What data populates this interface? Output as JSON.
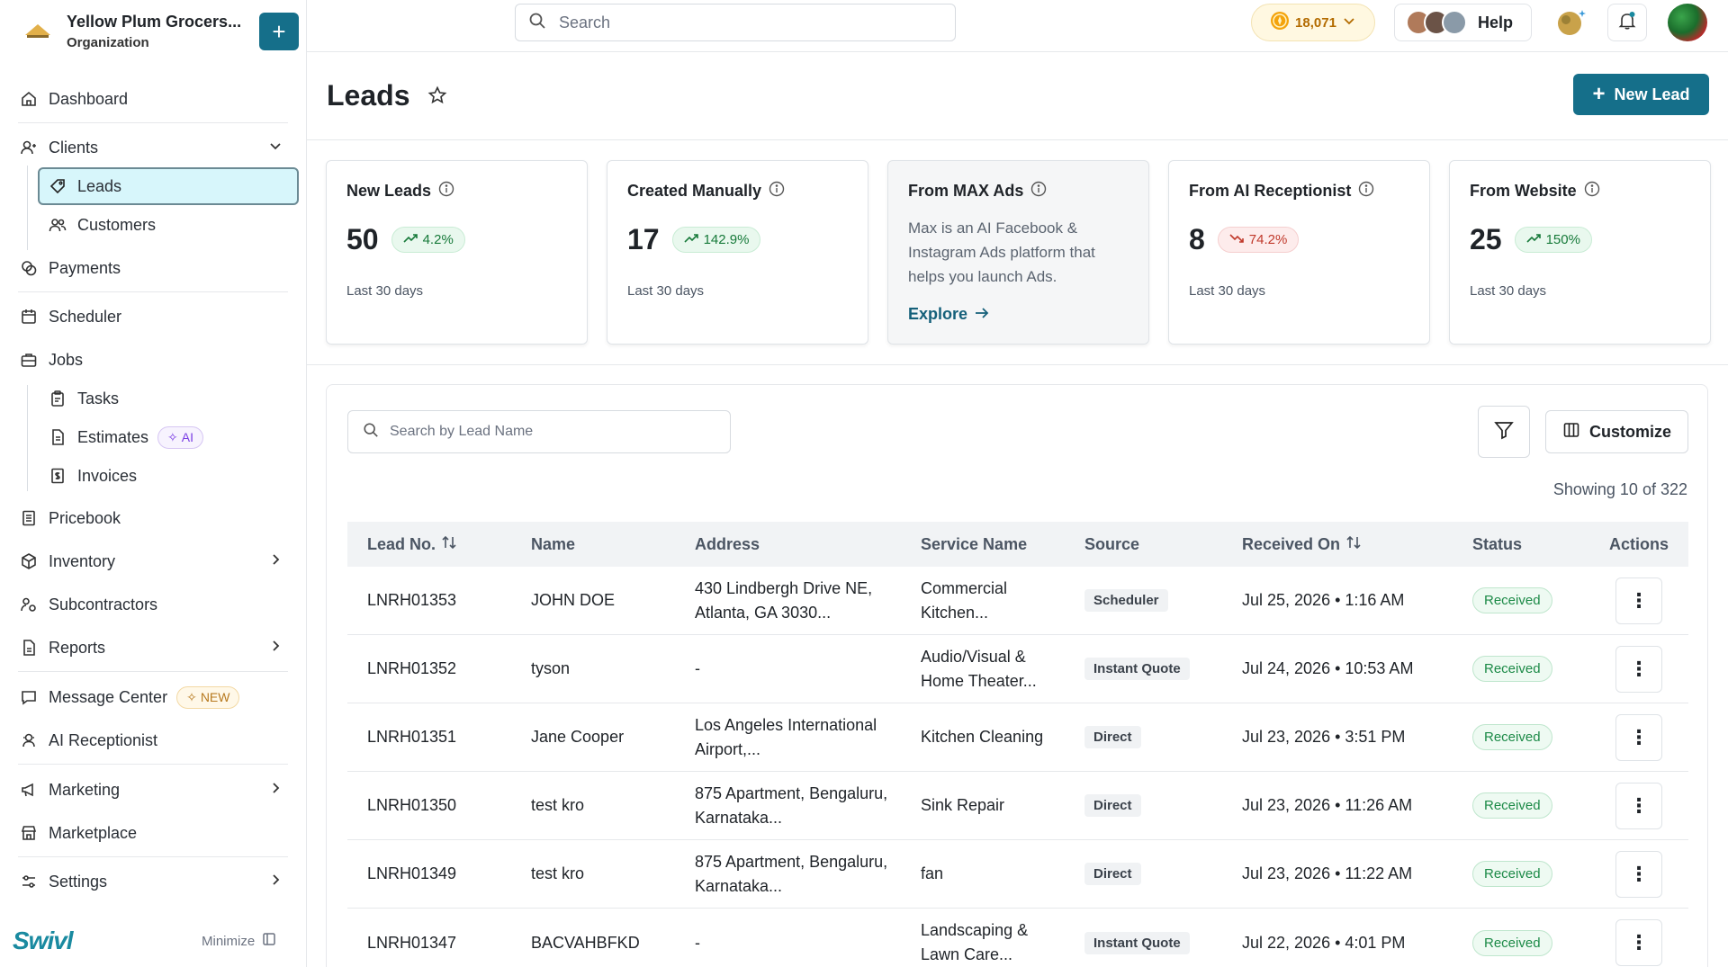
{
  "org": {
    "name": "Yellow Plum Grocers...",
    "subtitle": "Organization"
  },
  "sidebar": {
    "items": [
      {
        "label": "Dashboard"
      },
      {
        "label": "Clients"
      },
      {
        "label": "Leads"
      },
      {
        "label": "Customers"
      },
      {
        "label": "Payments"
      },
      {
        "label": "Scheduler"
      },
      {
        "label": "Jobs"
      },
      {
        "label": "Tasks"
      },
      {
        "label": "Estimates"
      },
      {
        "label": "Invoices"
      },
      {
        "label": "Pricebook"
      },
      {
        "label": "Inventory"
      },
      {
        "label": "Subcontractors"
      },
      {
        "label": "Reports"
      },
      {
        "label": "Message Center"
      },
      {
        "label": "AI Receptionist"
      },
      {
        "label": "Marketing"
      },
      {
        "label": "Marketplace"
      },
      {
        "label": "Settings"
      }
    ],
    "badges": {
      "ai": "AI",
      "new": "NEW"
    },
    "brand": "Swivl",
    "minimize": "Minimize"
  },
  "topbar": {
    "search_placeholder": "Search",
    "coins": "18,071",
    "help": "Help"
  },
  "page": {
    "title": "Leads",
    "new_button": "New Lead"
  },
  "cards": [
    {
      "title": "New Leads",
      "value": "50",
      "change": "4.2%",
      "trend": "up",
      "footer": "Last 30 days"
    },
    {
      "title": "Created Manually",
      "value": "17",
      "change": "142.9%",
      "trend": "up",
      "footer": "Last 30 days"
    },
    {
      "title": "From MAX Ads",
      "description": "Max is an AI Facebook & Instagram Ads platform that helps you launch Ads.",
      "link": "Explore"
    },
    {
      "title": "From AI Receptionist",
      "value": "8",
      "change": "74.2%",
      "trend": "down",
      "footer": "Last 30 days"
    },
    {
      "title": "From Website",
      "value": "25",
      "change": "150%",
      "trend": "up",
      "footer": "Last 30 days"
    }
  ],
  "table": {
    "search_placeholder": "Search by Lead Name",
    "customize": "Customize",
    "showing": "Showing 10 of 322",
    "columns": [
      "Lead No.",
      "Name",
      "Address",
      "Service Name",
      "Source",
      "Received On",
      "Status",
      "Actions"
    ],
    "rows": [
      {
        "lead_no": "LNRH01353",
        "name": "JOHN DOE",
        "address": "430 Lindbergh Drive NE, Atlanta, GA 3030...",
        "service": "Commercial Kitchen...",
        "source": "Scheduler",
        "received": "Jul 25, 2026 • 1:16 AM",
        "status": "Received"
      },
      {
        "lead_no": "LNRH01352",
        "name": "tyson",
        "address": "-",
        "service": "Audio/Visual & Home Theater...",
        "source": "Instant Quote",
        "received": "Jul 24, 2026 • 10:53 AM",
        "status": "Received"
      },
      {
        "lead_no": "LNRH01351",
        "name": "Jane Cooper",
        "address": "Los Angeles International Airport,...",
        "service": "Kitchen Cleaning",
        "source": "Direct",
        "received": "Jul 23, 2026 • 3:51 PM",
        "status": "Received"
      },
      {
        "lead_no": "LNRH01350",
        "name": "test kro",
        "address": "875 Apartment, Bengaluru, Karnataka...",
        "service": "Sink Repair",
        "source": "Direct",
        "received": "Jul 23, 2026 • 11:26 AM",
        "status": "Received"
      },
      {
        "lead_no": "LNRH01349",
        "name": "test kro",
        "address": "875 Apartment, Bengaluru, Karnataka...",
        "service": "fan",
        "source": "Direct",
        "received": "Jul 23, 2026 • 11:22 AM",
        "status": "Received"
      },
      {
        "lead_no": "LNRH01347",
        "name": "BACVAHBFKD",
        "address": "-",
        "service": "Landscaping & Lawn Care...",
        "source": "Instant Quote",
        "received": "Jul 22, 2026 • 4:01 PM",
        "status": "Received"
      }
    ]
  },
  "colors": {
    "accent": "#156f8a",
    "active_bg": "#d7f6fb",
    "success": "#1c8a47",
    "danger": "#c0392b"
  }
}
